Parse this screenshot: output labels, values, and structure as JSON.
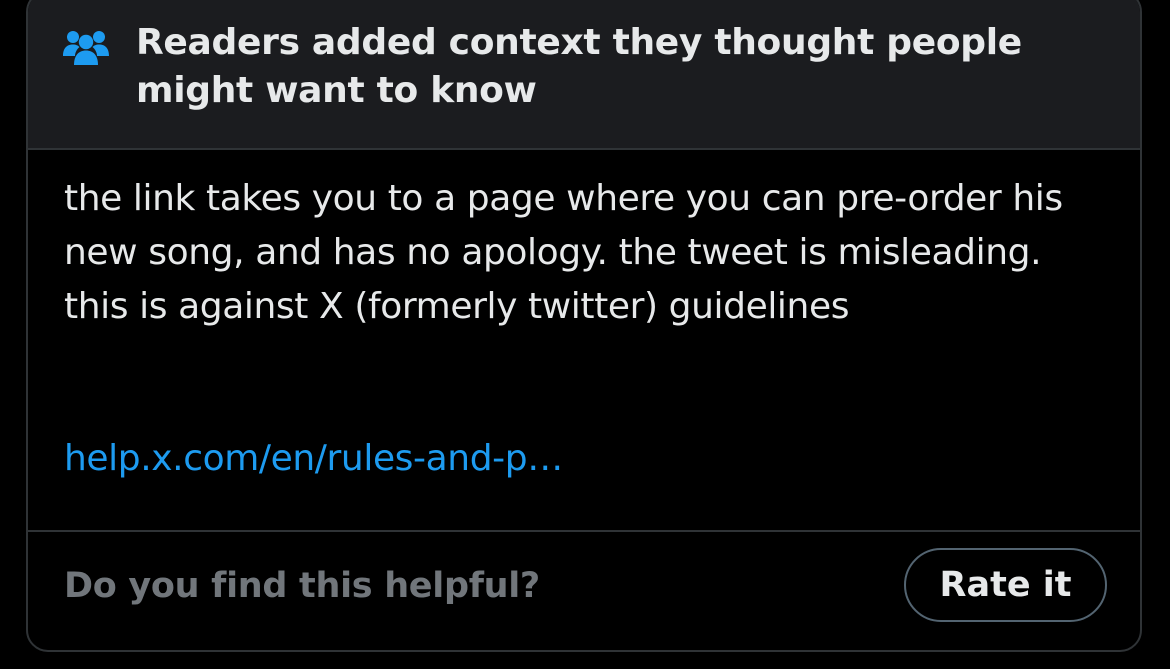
{
  "header": {
    "icon": "people-icon",
    "title": "Readers added context they thought people might want to know"
  },
  "note": {
    "paragraph1": "the link takes you to a page where you can pre-order his new song, and has no apology. the tweet is misleading.",
    "paragraph2": "this is against X (formerly twitter) guidelines",
    "link_text": "help.x.com/en/rules-and-p…"
  },
  "footer": {
    "question": "Do you find this helpful?",
    "rate_label": "Rate it"
  },
  "colors": {
    "background": "#000000",
    "header_bg": "#1b1c1f",
    "text": "#e7e9ea",
    "muted": "#71767b",
    "link": "#1d9bf0",
    "border": "#2f3336"
  }
}
